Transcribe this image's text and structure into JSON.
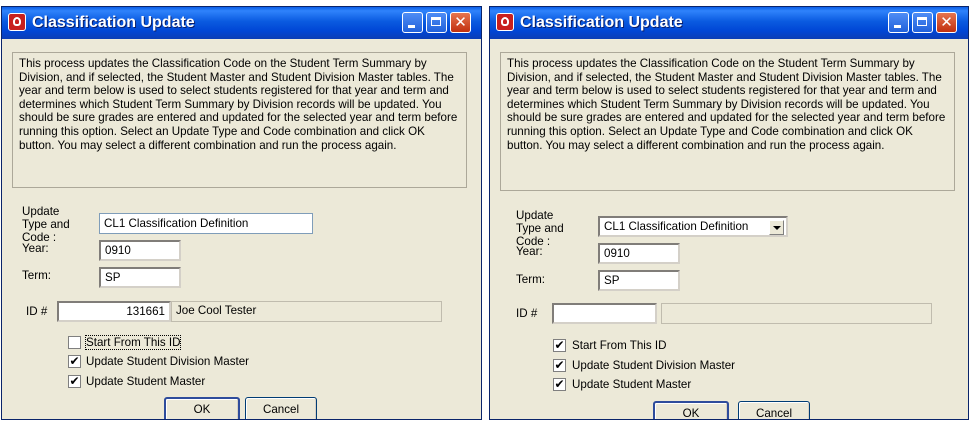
{
  "dialogs": [
    {
      "title": "Classification Update",
      "description": "This process updates the Classification Code on the Student Term Summary by Division, and if selected, the Student Master and Student Division Master tables. The year and term below is used to select students registered for that year and term and determines which Student Term Summary by Division records will be updated. You should be sure grades are entered and updated for the selected year and term before running this option. Select an Update Type and Code combination and click OK button. You may select a different combination and run the process again.",
      "update_type_label": "Update Type and Code :",
      "update_type_value": "CL1  Classification Definition",
      "year_label": "Year:",
      "year_value": "0910",
      "term_label": "Term:",
      "term_value": "SP",
      "id_label": "ID #",
      "id_value": "131661",
      "id_name": "Joe Cool Tester",
      "start_from_id": {
        "label": "Start From This ID",
        "checked": false
      },
      "update_division_master": {
        "label": "Update Student Division Master",
        "checked": true
      },
      "update_student_master": {
        "label": "Update Student Master",
        "checked": true
      },
      "ok_label": "OK",
      "cancel_label": "Cancel"
    },
    {
      "title": "Classification Update",
      "description": "This process updates the Classification Code on the Student Term Summary by Division, and if selected, the Student Master and Student Division Master tables. The year and term below is used to select students registered for that year and term and determines which Student Term Summary by Division records will be updated. You should be sure grades are entered and updated for the selected year and term before running this option. Select an Update Type and Code combination and click OK button. You may select a different combination and run the process again.",
      "update_type_label": "Update Type and Code :",
      "update_type_value": "CL1  Classification Definition",
      "year_label": "Year:",
      "year_value": "0910",
      "term_label": "Term:",
      "term_value": "SP",
      "id_label": "ID #",
      "id_value": "",
      "id_name": "",
      "start_from_id": {
        "label": "Start From This ID",
        "checked": true
      },
      "update_division_master": {
        "label": "Update Student Division Master",
        "checked": true
      },
      "update_student_master": {
        "label": "Update Student Master",
        "checked": true
      },
      "ok_label": "OK",
      "cancel_label": "Cancel"
    }
  ],
  "icons": {
    "app": "app-icon",
    "minimize": "minimize-icon",
    "maximize": "maximize-icon",
    "close": "close-icon",
    "dropdown": "chevron-down-icon",
    "check": "checkmark-icon"
  },
  "colors": {
    "titlebar": "#0054e3",
    "window_face": "#ece9d8",
    "close_button": "#d8542d"
  }
}
